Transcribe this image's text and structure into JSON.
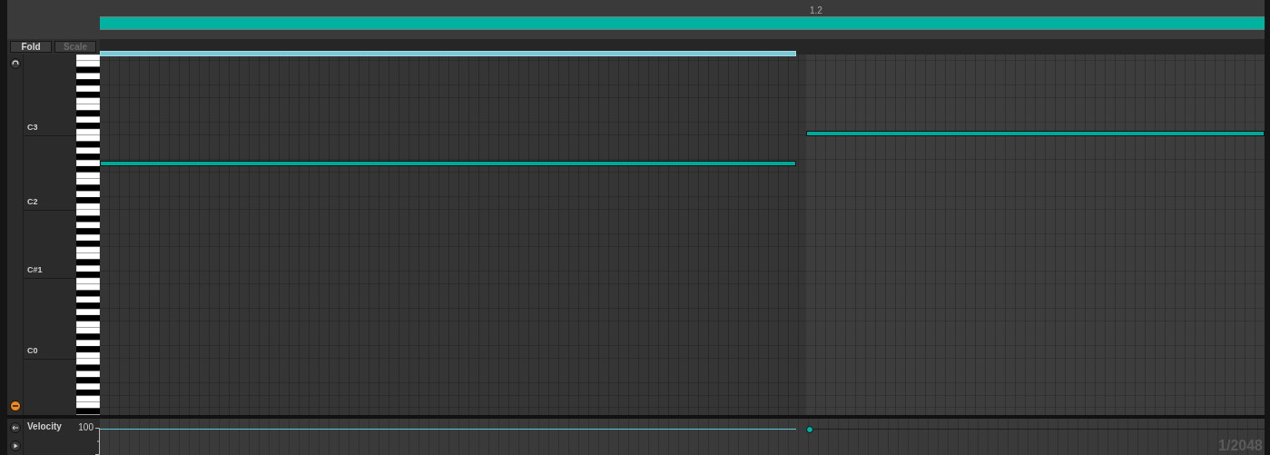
{
  "ruler": {
    "marker": "1.2"
  },
  "buttons": [
    {
      "label": "Fold",
      "disabled": false
    },
    {
      "label": "Scale",
      "disabled": true
    }
  ],
  "key_labels": [
    "C3",
    "C2",
    "C#1",
    "C0"
  ],
  "notes": [
    {
      "selected": true
    },
    {
      "selected": false
    },
    {
      "selected": false
    }
  ],
  "velocity_lane": {
    "label": "Velocity",
    "value": "100",
    "grid": "1/2048"
  }
}
